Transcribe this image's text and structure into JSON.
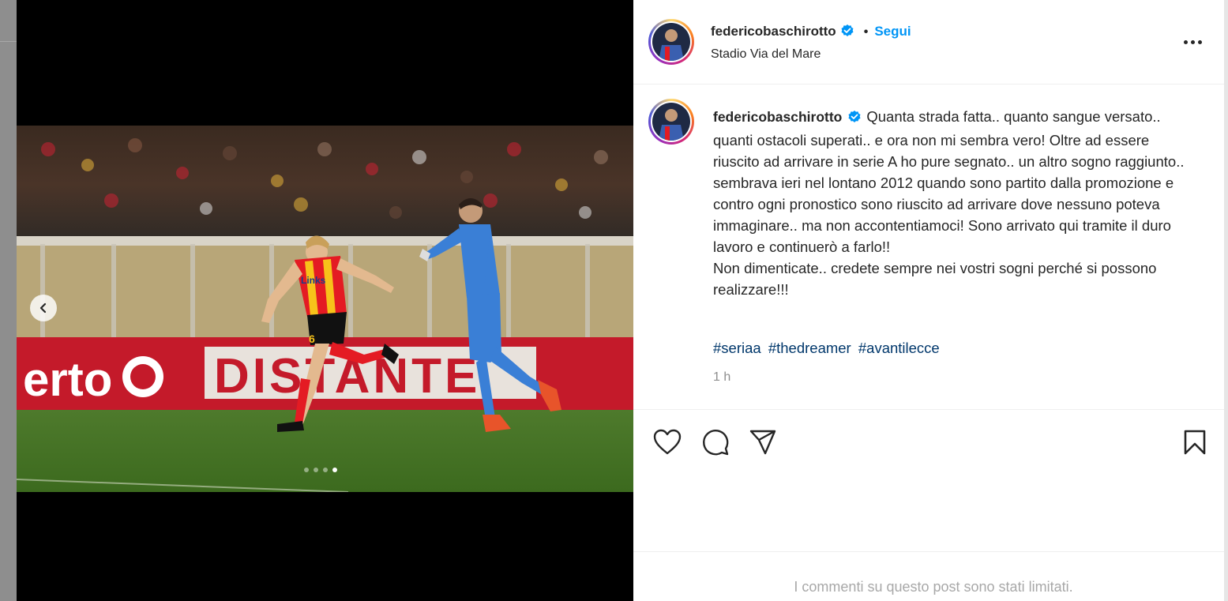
{
  "post": {
    "username": "federicobaschirotto",
    "follow_label": "Segui",
    "bullet": "•",
    "location": "Stadio Via del Mare",
    "caption_text": "Quanta strada fatta.. quanto sangue versato.. quanti ostacoli superati.. e ora non mi sembra vero! Oltre ad essere riuscito ad arrivare in serie A ho pure segnato.. un altro sogno raggiunto.. sembrava ieri nel lontano 2012 quando sono partito dalla promozione e contro ogni pronostico sono riuscito ad arrivare dove nessuno poteva immaginare.. ma non accontentiamoci! Sono arrivato qui tramite il duro lavoro e continuerò a farlo!!\nNon dimenticate.. credete sempre nei vostri sogni perché si possono realizzare!!!",
    "hashtags": [
      "#seriaa",
      "#thedreamer",
      "#avantilecce"
    ],
    "time_ago": "1 h",
    "comments_limited": "I commenti su questo post sono stati limitati."
  },
  "media": {
    "slide_count": 4,
    "active_slide": 4,
    "banner_text_left": "erto",
    "banner_text_right": "DISTANTE",
    "sponsor": "Links",
    "shirt_number": "6"
  },
  "icons": {
    "verified": "verified-badge-icon",
    "more": "more-options-icon",
    "prev": "chevron-left-icon",
    "like": "heart-icon",
    "comment": "comment-icon",
    "share": "share-icon",
    "save": "bookmark-icon"
  },
  "colors": {
    "link_blue": "#0095f6",
    "hashtag": "#00376b",
    "text": "#262626",
    "muted": "#8e8e8e"
  }
}
